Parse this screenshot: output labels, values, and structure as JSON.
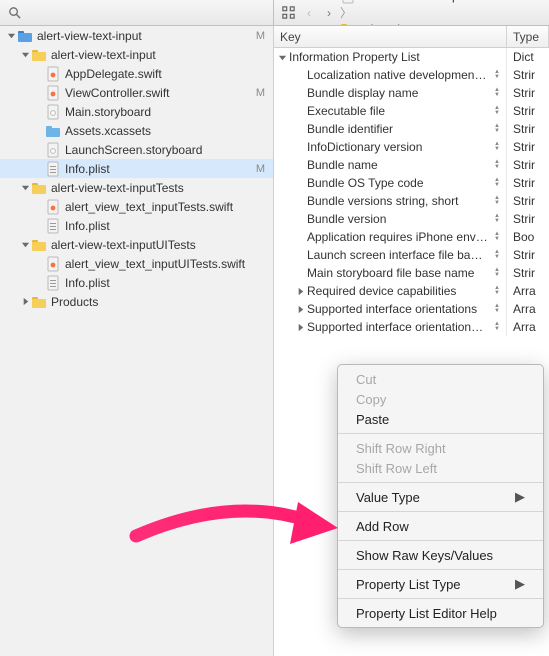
{
  "toolbar": {
    "icons": [
      "files-icon",
      "diff-icon",
      "hierarchy-icon",
      "search-icon",
      "warning-icon",
      "tests-icon",
      "activity-icon"
    ],
    "right_icons": [
      "related-icon",
      "app-icon"
    ],
    "nav": {
      "back": "‹",
      "fwd": "›"
    },
    "crumbs": [
      {
        "icon": "plist",
        "label": "alert-view-text-input"
      },
      {
        "icon": "folder",
        "label": "alert-vi"
      }
    ]
  },
  "tree": [
    {
      "d": 0,
      "open": true,
      "icon": "proj",
      "name": "alert-view-text-input",
      "badge": "M"
    },
    {
      "d": 1,
      "open": true,
      "icon": "folder",
      "name": "alert-view-text-input"
    },
    {
      "d": 2,
      "icon": "swift",
      "name": "AppDelegate.swift"
    },
    {
      "d": 2,
      "icon": "swift",
      "name": "ViewController.swift",
      "badge": "M"
    },
    {
      "d": 2,
      "icon": "storyboard",
      "name": "Main.storyboard"
    },
    {
      "d": 2,
      "icon": "xcassets",
      "name": "Assets.xcassets"
    },
    {
      "d": 2,
      "icon": "storyboard",
      "name": "LaunchScreen.storyboard"
    },
    {
      "d": 2,
      "icon": "plist",
      "name": "Info.plist",
      "badge": "M",
      "sel": true
    },
    {
      "d": 1,
      "open": true,
      "icon": "folder",
      "name": "alert-view-text-inputTests"
    },
    {
      "d": 2,
      "icon": "swift",
      "name": "alert_view_text_inputTests.swift"
    },
    {
      "d": 2,
      "icon": "plist",
      "name": "Info.plist"
    },
    {
      "d": 1,
      "open": true,
      "icon": "folder",
      "name": "alert-view-text-inputUITests"
    },
    {
      "d": 2,
      "icon": "swift",
      "name": "alert_view_text_inputUITests.swift"
    },
    {
      "d": 2,
      "icon": "plist",
      "name": "Info.plist"
    },
    {
      "d": 1,
      "open": false,
      "icon": "folder",
      "name": "Products"
    }
  ],
  "table": {
    "headers": {
      "key": "Key",
      "type": "Type"
    },
    "rows": [
      {
        "d": 0,
        "disc": "down",
        "k": "Information Property List",
        "t": "Dict"
      },
      {
        "d": 1,
        "k": "Localization native development re…",
        "t": "Strir",
        "ctrl": true
      },
      {
        "d": 1,
        "k": "Bundle display name",
        "t": "Strir",
        "ctrl": true
      },
      {
        "d": 1,
        "k": "Executable file",
        "t": "Strir",
        "ctrl": true
      },
      {
        "d": 1,
        "k": "Bundle identifier",
        "t": "Strir",
        "ctrl": true
      },
      {
        "d": 1,
        "k": "InfoDictionary version",
        "t": "Strir",
        "ctrl": true
      },
      {
        "d": 1,
        "k": "Bundle name",
        "t": "Strir",
        "ctrl": true
      },
      {
        "d": 1,
        "k": "Bundle OS Type code",
        "t": "Strir",
        "ctrl": true
      },
      {
        "d": 1,
        "k": "Bundle versions string, short",
        "t": "Strir",
        "ctrl": true
      },
      {
        "d": 1,
        "k": "Bundle version",
        "t": "Strir",
        "ctrl": true
      },
      {
        "d": 1,
        "k": "Application requires iPhone enviro…",
        "t": "Boo",
        "ctrl": true
      },
      {
        "d": 1,
        "k": "Launch screen interface file base…",
        "t": "Strir",
        "ctrl": true
      },
      {
        "d": 1,
        "k": "Main storyboard file base name",
        "t": "Strir",
        "ctrl": true
      },
      {
        "d": 1,
        "disc": "right",
        "k": "Required device capabilities",
        "t": "Arra",
        "ctrl": true
      },
      {
        "d": 1,
        "disc": "right",
        "k": "Supported interface orientations",
        "t": "Arra",
        "ctrl": true
      },
      {
        "d": 1,
        "disc": "right",
        "k": "Supported interface orientations (i…",
        "t": "Arra",
        "ctrl": true
      }
    ]
  },
  "context_menu": [
    {
      "label": "Cut",
      "dis": true
    },
    {
      "label": "Copy",
      "dis": true
    },
    {
      "label": "Paste"
    },
    {
      "sep": true
    },
    {
      "label": "Shift Row Right",
      "dis": true
    },
    {
      "label": "Shift Row Left",
      "dis": true
    },
    {
      "sep": true
    },
    {
      "label": "Value Type",
      "sub": true
    },
    {
      "sep": true
    },
    {
      "label": "Add Row"
    },
    {
      "sep": true
    },
    {
      "label": "Show Raw Keys/Values"
    },
    {
      "sep": true
    },
    {
      "label": "Property List Type",
      "sub": true
    },
    {
      "sep": true
    },
    {
      "label": "Property List Editor Help"
    }
  ]
}
